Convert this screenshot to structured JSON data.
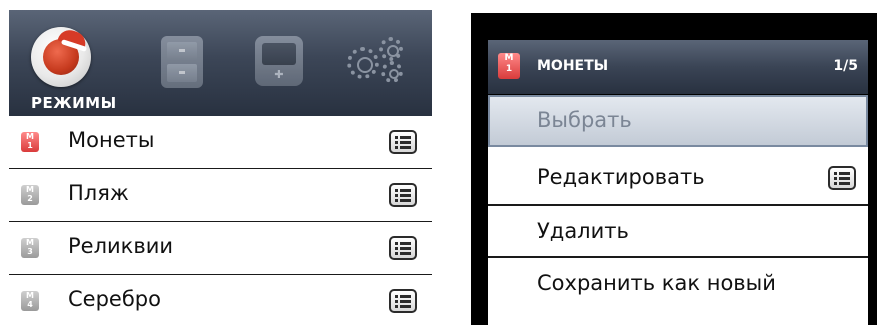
{
  "left_panel": {
    "header": {
      "title": "РЕЖИМЫ",
      "icons": [
        "coin-icon",
        "file-cabinet-icon",
        "device-icon",
        "gears-icon"
      ]
    },
    "rows": [
      {
        "label": "Монеты",
        "badge_letter": "M",
        "badge_number": "1",
        "active": true
      },
      {
        "label": "Пляж",
        "badge_letter": "M",
        "badge_number": "2",
        "active": false
      },
      {
        "label": "Реликвии",
        "badge_letter": "M",
        "badge_number": "3",
        "active": false
      },
      {
        "label": "Серебро",
        "badge_letter": "M",
        "badge_number": "4",
        "active": false
      }
    ]
  },
  "right_panel": {
    "header": {
      "badge_letter": "M",
      "badge_number": "1",
      "title": "МОНЕТЫ",
      "page": "1/5"
    },
    "items": [
      {
        "label": "Выбрать",
        "selected": true
      },
      {
        "label": "Редактировать",
        "has_menu": true
      },
      {
        "label": "Удалить"
      },
      {
        "label": "Сохранить как новый"
      }
    ]
  },
  "colors": {
    "header_top": "#5a6577",
    "header_bottom": "#283140",
    "active_badge": "#d93b3b",
    "inactive_badge": "#9a9a9a",
    "selected_item": "#c3cbd6"
  }
}
